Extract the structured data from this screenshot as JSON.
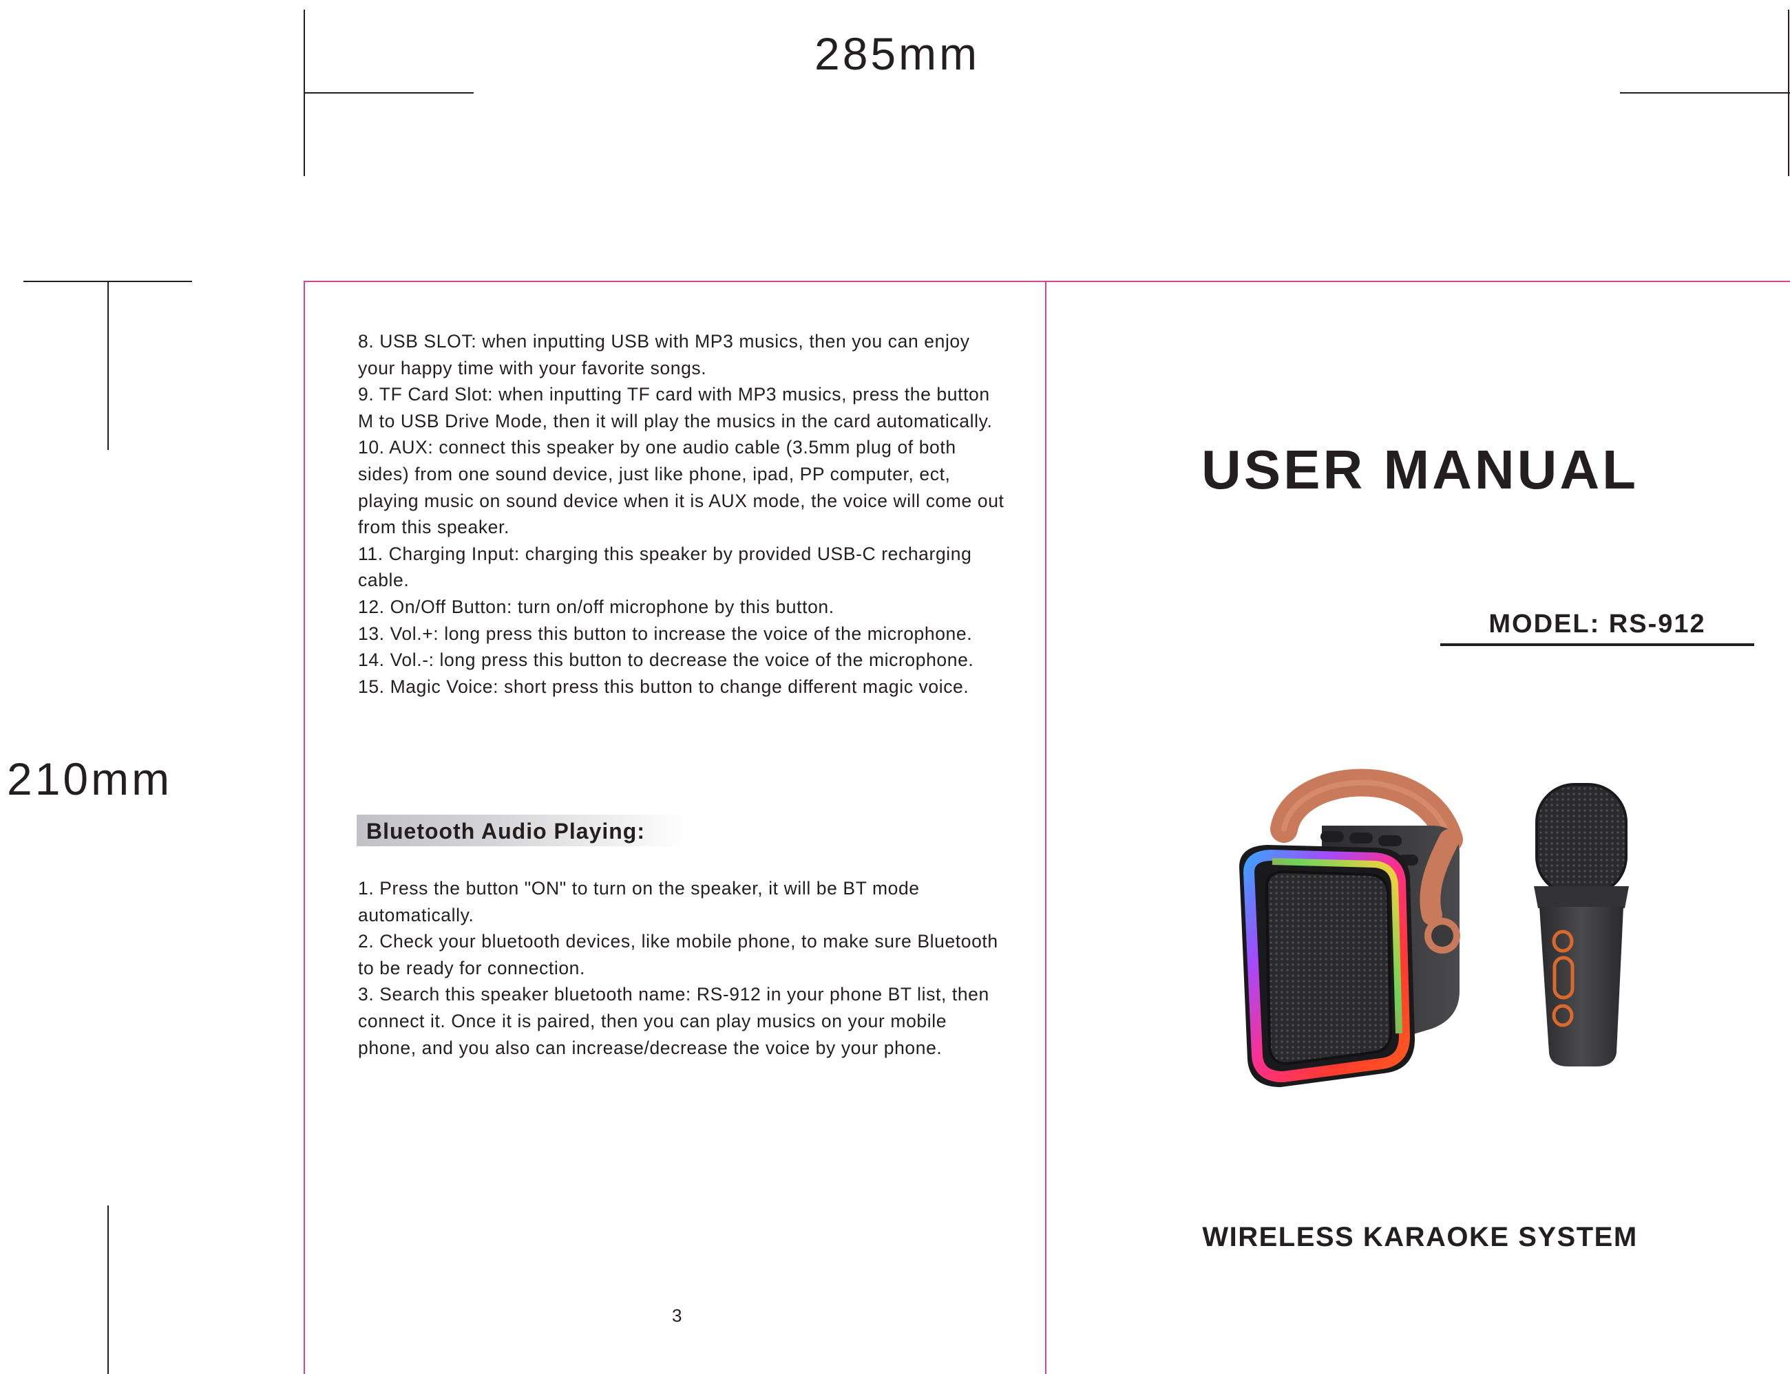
{
  "dimensions": {
    "width_label": "285mm",
    "height_label": "210mm"
  },
  "left_page": {
    "items": [
      "8. USB SLOT: when inputting USB with MP3 musics, then you can enjoy your happy time with your favorite songs.",
      "9. TF Card Slot: when inputting TF card with MP3 musics, press the button M to USB Drive Mode, then it will play the musics in the card automatically.",
      "10. AUX: connect this speaker by one audio cable (3.5mm plug of both sides) from one sound device, just like phone, ipad, PP computer, ect, playing music on sound device when it is AUX mode, the voice will come out from this speaker.",
      "11. Charging Input: charging this speaker by provided USB-C recharging cable.",
      "12. On/Off Button: turn on/off microphone by this button.",
      "13. Vol.+: long press this button to increase the voice of the microphone.",
      "14. Vol.-: long press this button to decrease the voice of the microphone.",
      "15. Magic Voice: short press this button to change different magic voice."
    ],
    "section_title": "Bluetooth Audio Playing:",
    "steps": [
      "1. Press the button \"ON\" to turn on the speaker, it will be BT mode automatically.",
      "2. Check your bluetooth devices, like mobile phone, to make sure Bluetooth to be ready for connection.",
      "3. Search this speaker bluetooth name: RS-912 in your phone BT list, then connect it. Once it is paired, then you can play musics on your mobile phone, and you also can increase/decrease the voice by your phone."
    ],
    "page_number": "3"
  },
  "cover": {
    "title": "USER MANUAL",
    "model": "MODEL:  RS-912",
    "subtitle": "WIRELESS KARAOKE SYSTEM"
  },
  "colors": {
    "trim_line": "#d6449a",
    "text": "#231f20",
    "handle": "#c87a5a",
    "speaker_body": "#3a3a3c"
  }
}
